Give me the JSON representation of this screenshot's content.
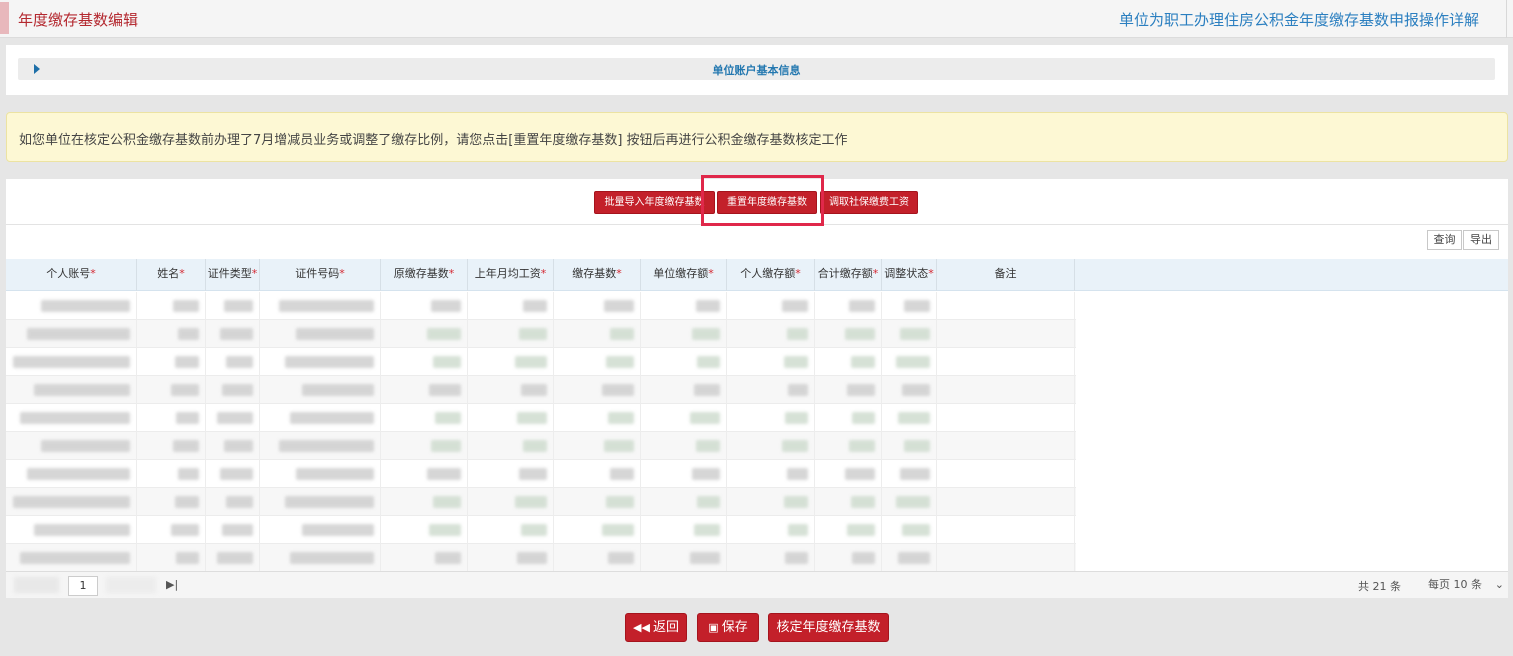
{
  "header": {
    "title": "年度缴存基数编辑",
    "help_link": "单位为职工办理住房公积金年度缴存基数申报操作详解"
  },
  "account_section": {
    "label": "单位账户基本信息"
  },
  "notice": {
    "text": "如您单位在核定公积金缴存基数前办理了7月增减员业务或调整了缴存比例，请您点击[重置年度缴存基数] 按钮后再进行公积金缴存基数核定工作"
  },
  "actions": {
    "batch_import": "批量导入年度缴存基数",
    "reset_base": "重置年度缴存基数",
    "fetch_social": "调取社保缴费工资"
  },
  "toolbar": {
    "query": "查询",
    "export": "导出"
  },
  "table": {
    "columns": [
      {
        "label": "个人账号",
        "required": "*"
      },
      {
        "label": "姓名",
        "required": "*"
      },
      {
        "label": "证件类型",
        "required": "*"
      },
      {
        "label": "证件号码",
        "required": "*"
      },
      {
        "label": "原缴存基数",
        "required": "*"
      },
      {
        "label": "上年月均工资",
        "required": "*"
      },
      {
        "label": "缴存基数",
        "required": "*"
      },
      {
        "label": "单位缴存额",
        "required": "*"
      },
      {
        "label": "个人缴存额",
        "required": "*"
      },
      {
        "label": "合计缴存额",
        "required": "*"
      },
      {
        "label": "调整状态",
        "required": "*"
      },
      {
        "label": "备注",
        "required": ""
      }
    ]
  },
  "pager": {
    "current_page": "1",
    "last_icon": "▶|",
    "total": "共 21 条",
    "per_page": "每页 10 条"
  },
  "footer": {
    "back": "返回",
    "save": "保存",
    "confirm": "核定年度缴存基数"
  },
  "colors": {
    "primary": "#c3202a",
    "title": "#b4282f",
    "link": "#2b7fc0",
    "highlight": "#e0284a"
  }
}
